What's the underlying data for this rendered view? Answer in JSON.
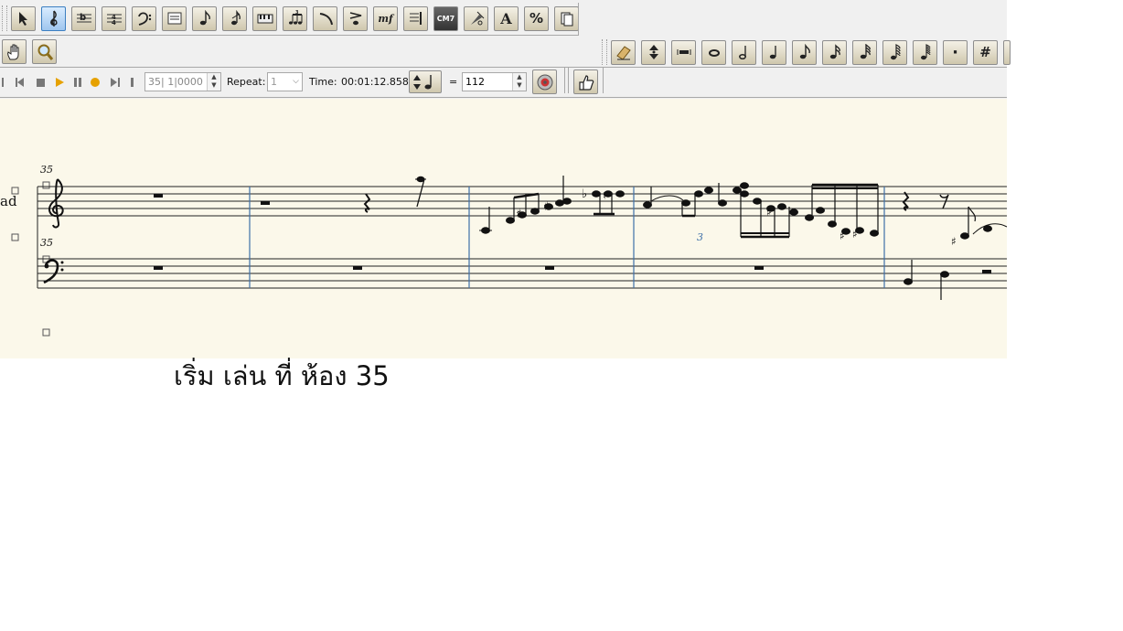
{
  "toolbar_row1": {
    "icons": [
      "select-arrow-icon",
      "treble-clef-icon",
      "key-signature-icon",
      "time-signature-icon",
      "bass-clef-icon",
      "staff-text-icon",
      "eighth-note-icon",
      "grace-note-icon",
      "keyboard-icon",
      "tuplet-icon",
      "slur-icon",
      "accent-icon",
      "dynamics-icon",
      "repeat-barline-icon",
      "chord-symbol-icon",
      "guitar-fret-icon",
      "text-icon",
      "percent-icon",
      "copy-page-icon"
    ],
    "dynamics_label": "mf",
    "chord_label": "CM7",
    "text_label": "A",
    "percent_label": "%"
  },
  "toolbar_row2_left": {
    "icons": [
      "hand-icon",
      "zoom-icon"
    ]
  },
  "toolbar_row2_right": {
    "icons": [
      "eraser-icon",
      "up-down-icon",
      "multirest-icon",
      "whole-note-icon",
      "half-note-icon",
      "quarter-note-icon",
      "eighth-note-icon",
      "sixteenth-note-icon",
      "thirty-second-note-icon",
      "sixty-fourth-note-icon",
      "one-twenty-eighth-note-icon",
      "dot-icon",
      "sharp-icon"
    ],
    "sharp_label": "#",
    "dot_label": "·"
  },
  "transport": {
    "position": "35| 1|0000",
    "repeat_label": "Repeat:",
    "repeat_value": "1",
    "time_label": "Time:",
    "time_value": "00:01:12.858",
    "equals": "=",
    "tempo": "112"
  },
  "score": {
    "instrument_partial": "ad",
    "measure_number_treble": "35",
    "measure_number_bass": "35",
    "triplet_label": "3"
  },
  "caption": "เริ่ม เล่น ที่ ห้อง 35",
  "colors": {
    "toolbar_bg": "#f0f0f0",
    "paper": "#fbf8ea",
    "barline": "#3d6fa8",
    "button_active": "#9fc6ee"
  }
}
